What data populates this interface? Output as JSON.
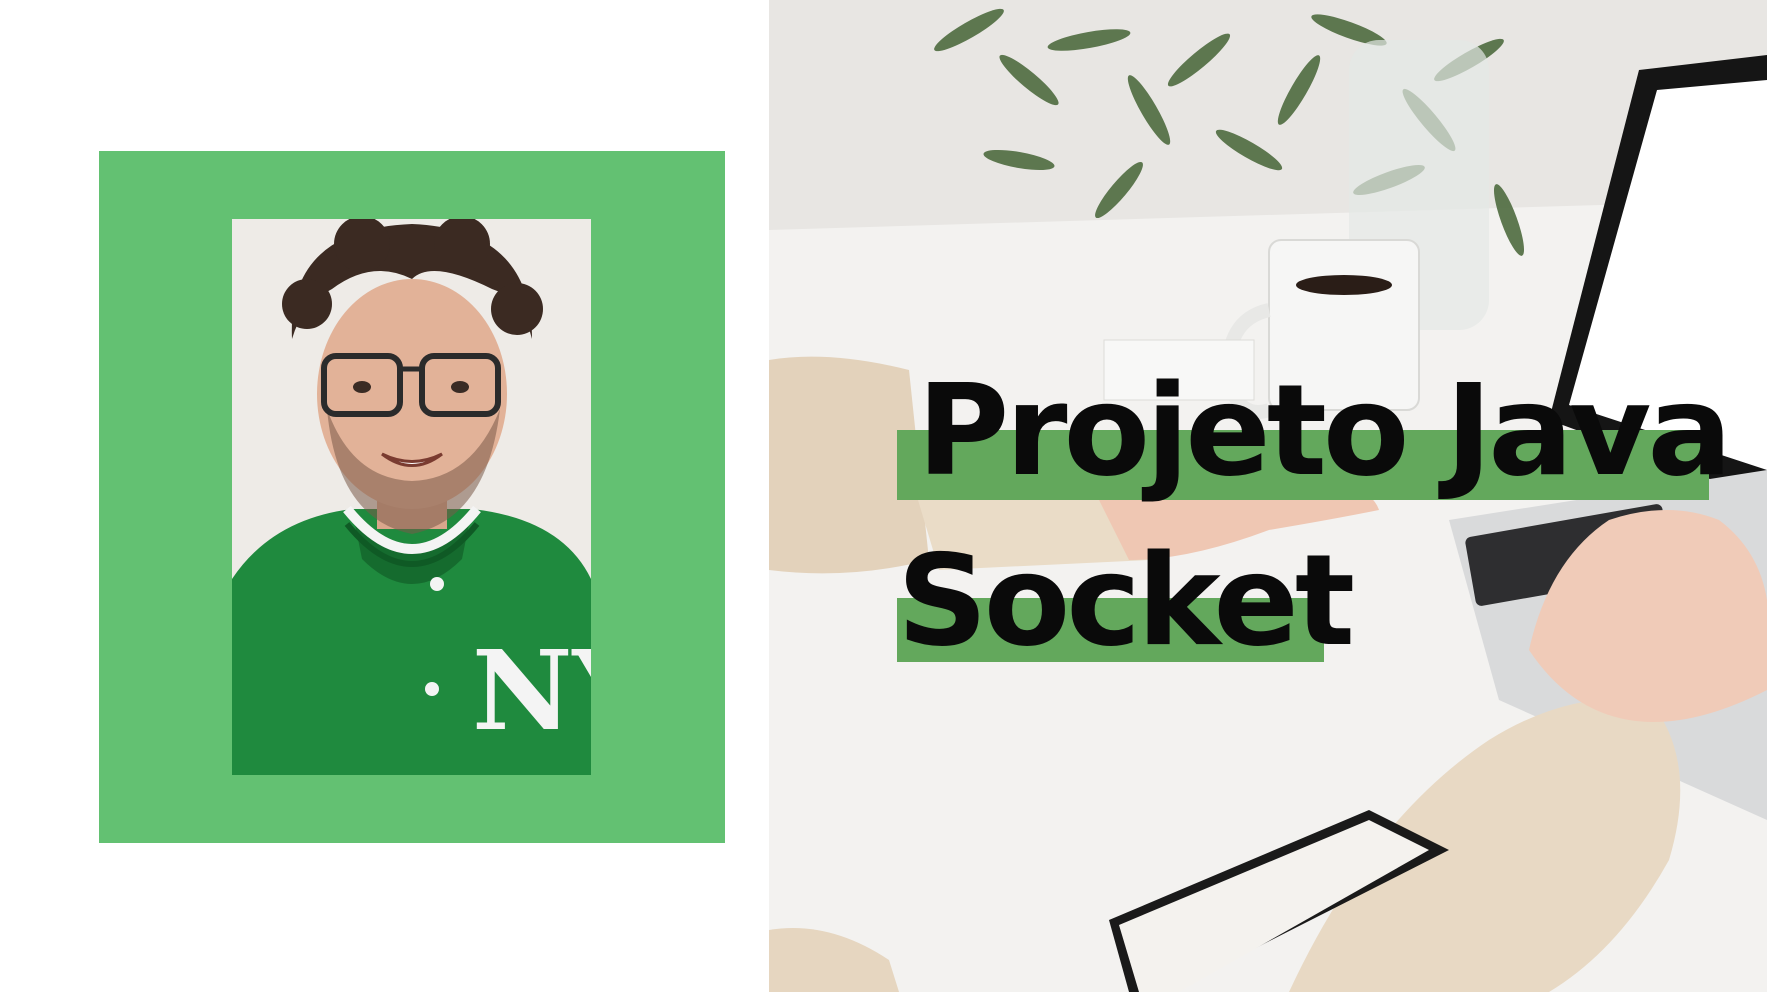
{
  "title": {
    "line1": "Projeto Java",
    "line2": "Socket"
  },
  "colors": {
    "frame_green": "#63c172",
    "highlight_green": "#63a85c",
    "title_text": "#0a0a0a",
    "background": "#ffffff"
  },
  "images": {
    "presenter": "presenter-photo",
    "workspace": "workspace-photo"
  }
}
